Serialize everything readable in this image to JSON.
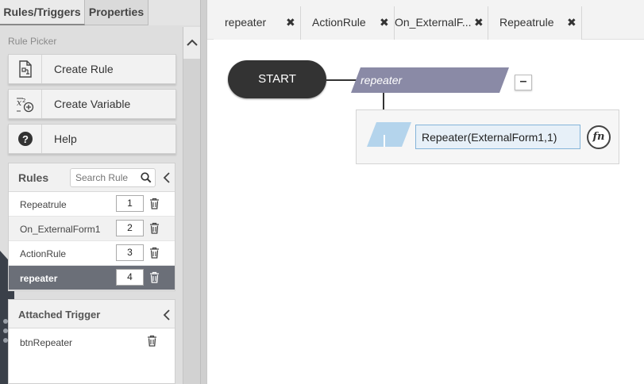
{
  "top_tabs": {
    "rules_triggers": "Rules/Triggers",
    "properties": "Properties"
  },
  "picker": {
    "title": "Rule Picker",
    "create_rule": "Create Rule",
    "create_variable": "Create Variable",
    "help": "Help"
  },
  "rules": {
    "title": "Rules",
    "search_placeholder": "Search Rule",
    "items": [
      {
        "name": "Repeatrule",
        "order": "1"
      },
      {
        "name": "On_ExternalForm1",
        "order": "2"
      },
      {
        "name": "ActionRule",
        "order": "3"
      },
      {
        "name": "repeater",
        "order": "4"
      }
    ]
  },
  "trigger": {
    "title": "Attached Trigger",
    "item": "btnRepeater"
  },
  "editor_tabs": [
    {
      "label": "repeater"
    },
    {
      "label": "ActionRule"
    },
    {
      "label": "On_ExternalF..."
    },
    {
      "label": "Repeatrule"
    }
  ],
  "canvas": {
    "start_label": "START",
    "rule_node_label": "repeater",
    "collapse_symbol": "–",
    "expression": "Repeater(ExternalForm1,1)",
    "fn_label": "fn"
  },
  "colors": {
    "rule_node": "#8a8aa6",
    "action_shape": "#b4d4ec",
    "selected_row": "#6b6f78"
  }
}
